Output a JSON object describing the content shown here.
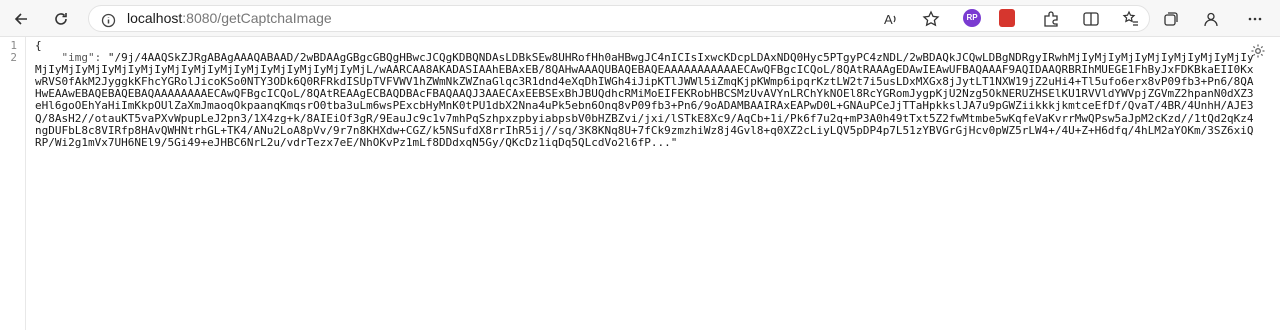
{
  "browser": {
    "url_host": "localhost",
    "url_path": ":8080/getCaptchaImage",
    "profile_badge": "RP",
    "icons": [
      "back-icon",
      "refresh-icon",
      "info-icon",
      "read-aloud-icon",
      "favorite-icon",
      "extensions-icon",
      "split-screen-icon",
      "favorites-bar-icon",
      "collections-icon",
      "profile-icon",
      "more-icon"
    ]
  },
  "viewer": {
    "line_numbers": [
      "1",
      "2"
    ],
    "line1": "{",
    "json_key": "\"img\": ",
    "json_value": "\"/9j/4AAQSkZJRgABAgAAAQABAAD/2wBDAAgGBgcGBQgHBwcJCQgKDBQNDAsLDBkSEw8UHRofHh0aHBwgJC4nICIsIxwcKDcpLDAxNDQ0Hyc5PTgyPC4zNDL/2wBDAQkJCQwLDBgNDRgyIRwhMjIyMjIyMjIyMjIyMjIyMjIyMjIyMjIyMjIyMjIyMjIyMjIyMjIyMjIyMjIyMjIyMjIyMjIyMjIyMjL/wAARCAA8AKADASIAAhEBAxEB/8QAHwAAAQUBAQEBAQEAAAAAAAAAAAECAwQFBgcICQoL/8QAtRAAAgEDAwIEAwUFBAQAAAF9AQIDAAQRBRIhMUEGE1FhByJxFDKBkaEII0KxwRVS0fAkM2JyggkKFhcYGRolJicoKSo0NTY3ODk6Q0RFRkdISUpTVFVWV1hZWmNkZWZnaGlqc3R1dnd4eXqDhIWGh4iJipKTlJWWl5iZmqKjpKWmp6ipqrKztLW2t7i5usLDxMXGx8jJytLT1NXW19jZ2uHi4+Tl5ufo6erx8vP09fb3+Pn6/8QAHwEAAwEBAQEBAQEBAQAAAAAAAAECAwQFBgcICQoL/8QAtREAAgECBAQDBAcFBAQAAQJ3AAECAxEEBSExBhJBUQdhcRMiMoEIFEKRobHBCSMzUvAVYnLRChYkNOEl8RcYGRomJygpKjU2Nzg5OkNERUZHSElKU1RVVldYWVpjZGVmZ2hpanN0dXZ3eHl6goOEhYaHiImKkpOUlZaXmJmaoqOkpaanqKmqsrO0tba3uLm6wsPExcbHyMnK0tPU1dbX2Nna4uPk5ebn6Onq8vP09fb3+Pn6/9oADAMBAAIRAxEAPwD0L+GNAuPCeJjTTaHpkkslJA7u9pGWZiikkkjkmtceEfDf/QvaT/4BR/4UnhH/AJE3Q/8AsH2//otauKT5vaPXvWpupLeJ2pn3/1X4zg+k/8AIEiOf3gR/9EauJc9c1v7mhPqSzhpxzpbyiabpsbV0bHZBZvi/jxi/lSTkE8Xc9/AqCb+1i/Pk6f7u2q+mP3A0h49tTxt5Z2fwMtmbe5wKqfeVaKvrrMwQPsw5aJpM2cKzd//1tQd2qKz4ngDUFbL8c8VIRfp8HAvQWHNtrhGL+TK4/ANu2LoA8pVv/9r7n8KHXdw+CGZ/k5NSufdX8rrIhR5ij//sq/3K8KNq8U+7fCk9zmzhiWz8j4Gvl8+q0XZ2cLiyLQV5pDP4p7L51zYBVGrGjHcv0pWZ5rLW4+/4U+Z+H6dfq/4hLM2aYOKm/3SZ6xiQRP/Wi2g1mVx7UH6NEl9/5Gi49+eJHBC6NrL2u/vdrTezx7eE/NhOKvPz1mLf8DDdxqN5Gy/QKcDz1iqDq5QLcdVo2l6fP...\""
  }
}
